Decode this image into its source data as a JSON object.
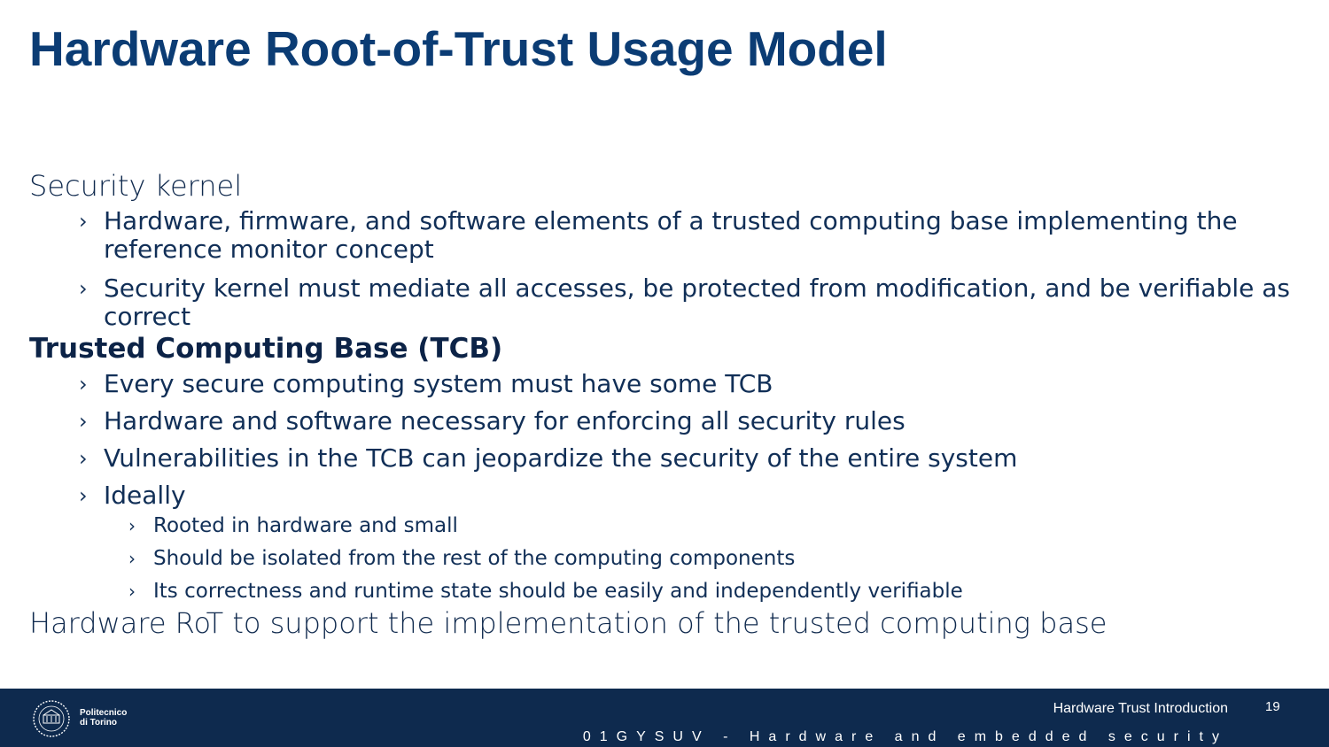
{
  "title": "Hardware Root-of-Trust Usage Model",
  "sections": {
    "security_kernel": {
      "heading": "Security kernel",
      "bullets": [
        "Hardware, firmware, and software elements of a trusted computing base implementing the reference monitor concept",
        "Security kernel must mediate all accesses, be protected from modification, and be verifiable as correct"
      ]
    },
    "tcb": {
      "heading": "Trusted Computing Base (TCB)",
      "bullets": [
        "Every secure computing system must have some TCB",
        "Hardware and software necessary for enforcing all security rules",
        "Vulnerabilities in the TCB can jeopardize the security of the entire system",
        "Ideally"
      ],
      "ideally_sub": [
        "Rooted in hardware and small",
        "Should be isolated from the rest of the computing components",
        "Its correctness and runtime state should be easily and independently verifiable"
      ]
    },
    "conclusion": "Hardware RoT to support the implementation of the trusted computing base"
  },
  "bullet_glyph": "›",
  "footer": {
    "logo_line1": "Politecnico",
    "logo_line2": "di Torino",
    "presentation_title": "Hardware Trust Introduction",
    "page_number": "19",
    "course": "01GYSUV - Hardware and embedded security"
  },
  "colors": {
    "title": "#0b3c74",
    "text": "#112f57",
    "footer_bg": "#0e2a4e"
  }
}
